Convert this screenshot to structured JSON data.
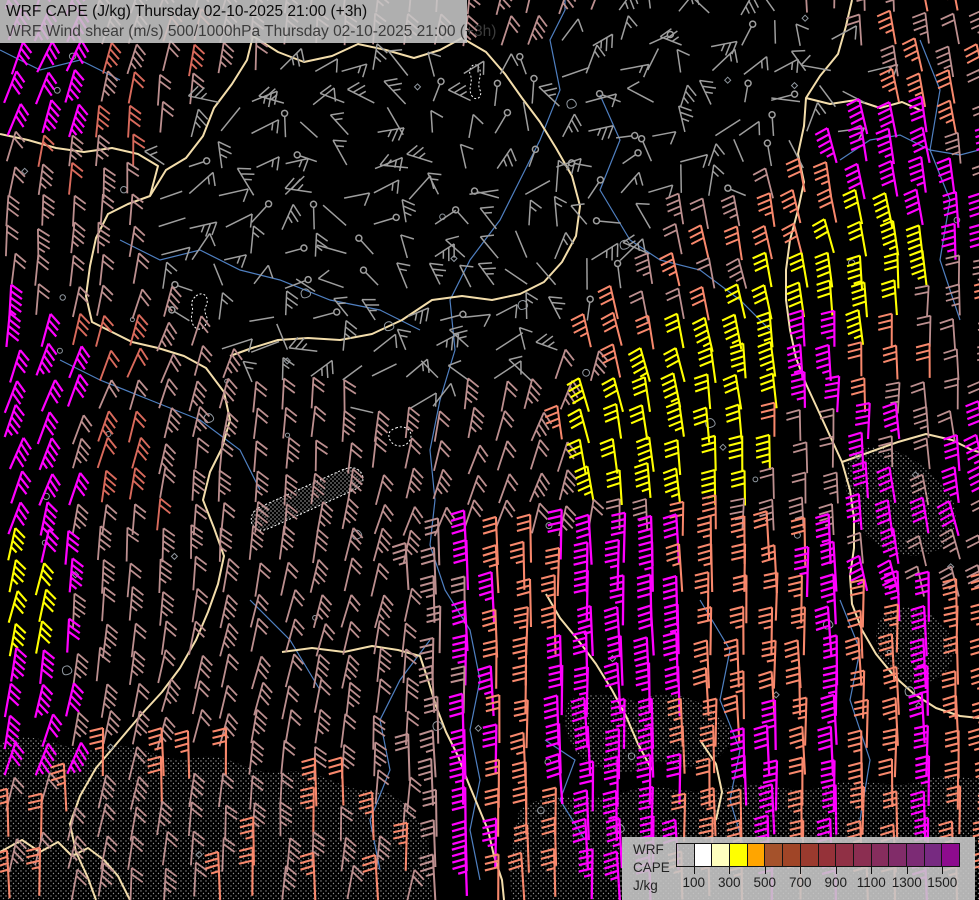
{
  "titles": {
    "line1": "WRF CAPE (J/kg) Thursday 02-10-2025 21:00 (+3h)",
    "line2": "WRF Wind shear (m/s) 500/1000hPa Thursday 02-10-2025 21:00 (+3h)"
  },
  "legend": {
    "labels": [
      "WRF",
      "CAPE",
      "J/kg"
    ],
    "tick_labels": [
      "100",
      "300",
      "500",
      "700",
      "900",
      "1100",
      "1300",
      "1500"
    ],
    "cell_colors": [
      "transparent",
      "#ffffff",
      "#ffffbe",
      "#ffff00",
      "#ffa500",
      "#a5522b",
      "#a04527",
      "#9a3a2e",
      "#953239",
      "#903045",
      "#8b2e51",
      "#862d5d",
      "#812c69",
      "#7c2b75",
      "#772a81",
      "#8d0b8d"
    ]
  },
  "map": {
    "background": "#000000",
    "border_color": "#f3ddab",
    "river_color": "#4f7fc0",
    "contour_color": "#ffffff",
    "stipple_color": "#8f8f8f",
    "symbol_color": "#8f979f",
    "barb_colors": {
      "weak_gray": "#9e9e9e",
      "moderate_rosybrown": "#bc8f8f",
      "strong_salmon": "#f8886c",
      "strong_red_salmon": "#d96a5c",
      "very_strong_yellow": "#ffff00",
      "extreme_magenta": "#ff00ff"
    }
  }
}
